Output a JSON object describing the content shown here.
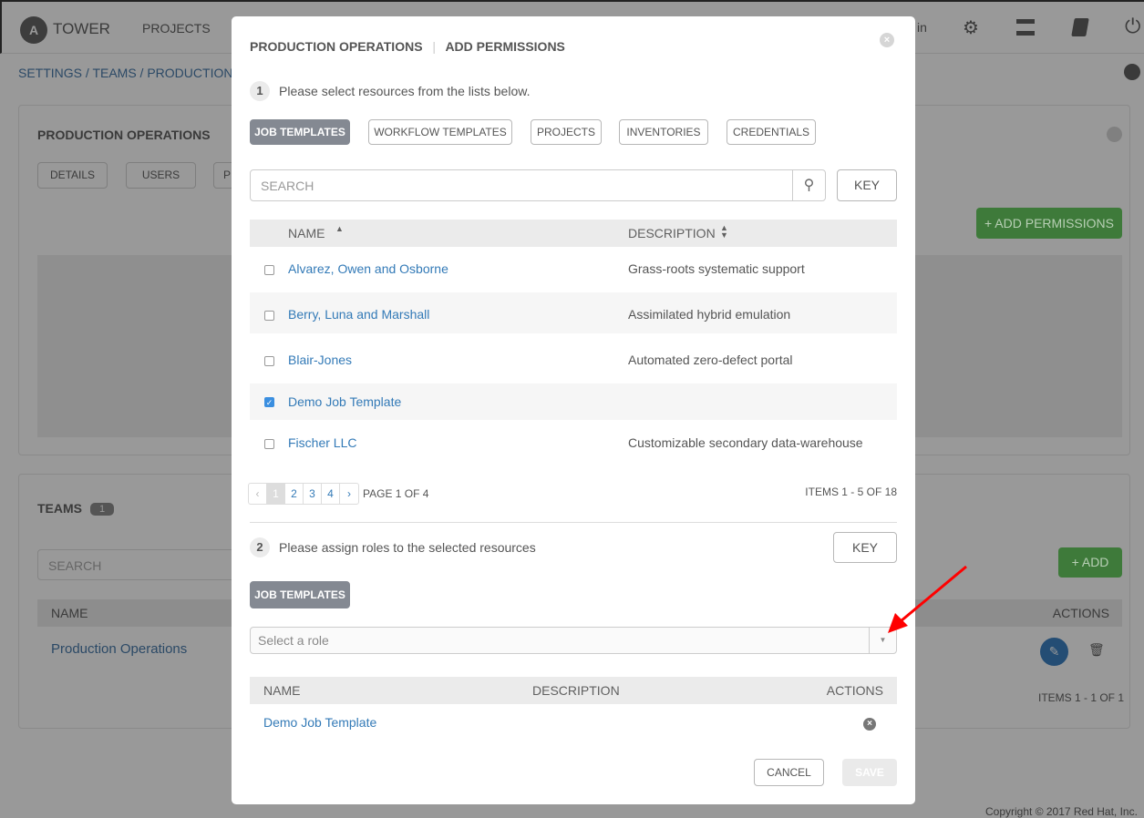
{
  "background": {
    "nav": {
      "brand": "TOWER",
      "projects": "PROJECTS",
      "user": "in",
      "icons": [
        "gear-icon",
        "server-icon",
        "book-icon",
        "power-icon"
      ]
    },
    "breadcrumb": [
      "SETTINGS /",
      "TEAMS /",
      "PRODUCTION"
    ],
    "team_panel": {
      "title": "PRODUCTION OPERATIONS",
      "tabs": [
        "DETAILS",
        "USERS",
        "P"
      ],
      "add_permissions": "+ ADD PERMISSIONS"
    },
    "teams_panel": {
      "title": "TEAMS",
      "count": "1",
      "search_placeholder": "SEARCH",
      "add": "+ ADD",
      "col_name": "NAME",
      "col_actions": "ACTIONS",
      "rows": [
        {
          "name": "Production Operations"
        }
      ],
      "items": "ITEMS  1 - 1 OF 1"
    },
    "copyright": "Copyright © 2017 Red Hat, Inc."
  },
  "modal": {
    "title": "PRODUCTION OPERATIONS",
    "subtitle": "ADD PERMISSIONS",
    "step1": {
      "num": "1",
      "text": "Please select resources from the lists below."
    },
    "tabs": [
      {
        "label": "JOB TEMPLATES",
        "active": true
      },
      {
        "label": "WORKFLOW TEMPLATES"
      },
      {
        "label": "PROJECTS"
      },
      {
        "label": "INVENTORIES"
      },
      {
        "label": "CREDENTIALS"
      }
    ],
    "search_placeholder": "SEARCH",
    "key": "KEY",
    "columns": {
      "name": "NAME",
      "description": "DESCRIPTION"
    },
    "rows": [
      {
        "name": "Alvarez, Owen and Osborne",
        "description": "Grass-roots systematic support",
        "checked": false
      },
      {
        "name": "Berry, Luna and Marshall",
        "description": "Assimilated hybrid emulation",
        "checked": false
      },
      {
        "name": "Blair-Jones",
        "description": "Automated zero-defect portal",
        "checked": false
      },
      {
        "name": "Demo Job Template",
        "description": "",
        "checked": true
      },
      {
        "name": "Fischer LLC",
        "description": "Customizable secondary data-warehouse",
        "checked": false
      }
    ],
    "pagination": {
      "pages": [
        "‹",
        "1",
        "2",
        "3",
        "4",
        "›"
      ],
      "current": "1",
      "page_label": "PAGE 1 OF 4",
      "items": "ITEMS  1 - 5 OF 18"
    },
    "step2": {
      "num": "2",
      "text": "Please assign roles to the selected resources",
      "key": "KEY",
      "tab": "JOB TEMPLATES",
      "role_placeholder": "Select a role"
    },
    "selected": {
      "columns": {
        "name": "NAME",
        "description": "DESCRIPTION",
        "actions": "ACTIONS"
      },
      "rows": [
        {
          "name": "Demo Job Template"
        }
      ]
    },
    "cancel": "CANCEL",
    "save": "SAVE"
  },
  "annotation_color": "#ff0000"
}
